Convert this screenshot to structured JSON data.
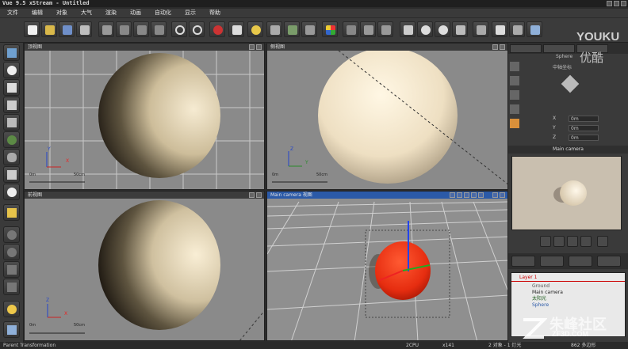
{
  "window": {
    "title": "Vue 9.5 xStream - Untitled"
  },
  "menu": [
    "文件",
    "编辑",
    "对象",
    "大气",
    "渲染",
    "动画",
    "自动化",
    "显示",
    "帮助"
  ],
  "viewports": {
    "top": {
      "title": "顶视图",
      "scale_start": "0m",
      "scale_end": "50cm",
      "axis_x": "X",
      "axis_y": "Y"
    },
    "side": {
      "title": "侧视图",
      "scale_start": "0m",
      "scale_end": "50cm",
      "axis_x": "Y",
      "axis_y": "Z"
    },
    "front": {
      "title": "前视图",
      "scale_start": "0m",
      "scale_end": "50cm",
      "axis_x": "X",
      "axis_y": "Z"
    },
    "camera": {
      "title": "Main camera 视图"
    }
  },
  "right_panel": {
    "object_name": "Sphere",
    "rotation_label": "中轴坐标",
    "fields": [
      {
        "label": "X",
        "value": "0m"
      },
      {
        "label": "Y",
        "value": "0m"
      },
      {
        "label": "Z",
        "value": "0m"
      }
    ],
    "camera_bar": "Main camera",
    "scene_layer": "Layer 1",
    "scene_items": [
      "Ground",
      "Main camera",
      "太阳光",
      "Sphere"
    ]
  },
  "status": {
    "left": "Parent Transformation",
    "cpu": "2CPU",
    "zoom": "x141",
    "selection": "2 对象 - 1 灯光",
    "polys": "862 多边形"
  },
  "watermarks": {
    "youku_latin": "YOUKU",
    "youku_cn": "优酷",
    "zf_cn": "朱峰社区",
    "zf_url": "ZF3D.COM"
  },
  "colors": {
    "accent": "#2b5aa8",
    "selected_sphere": "#e62d10"
  }
}
